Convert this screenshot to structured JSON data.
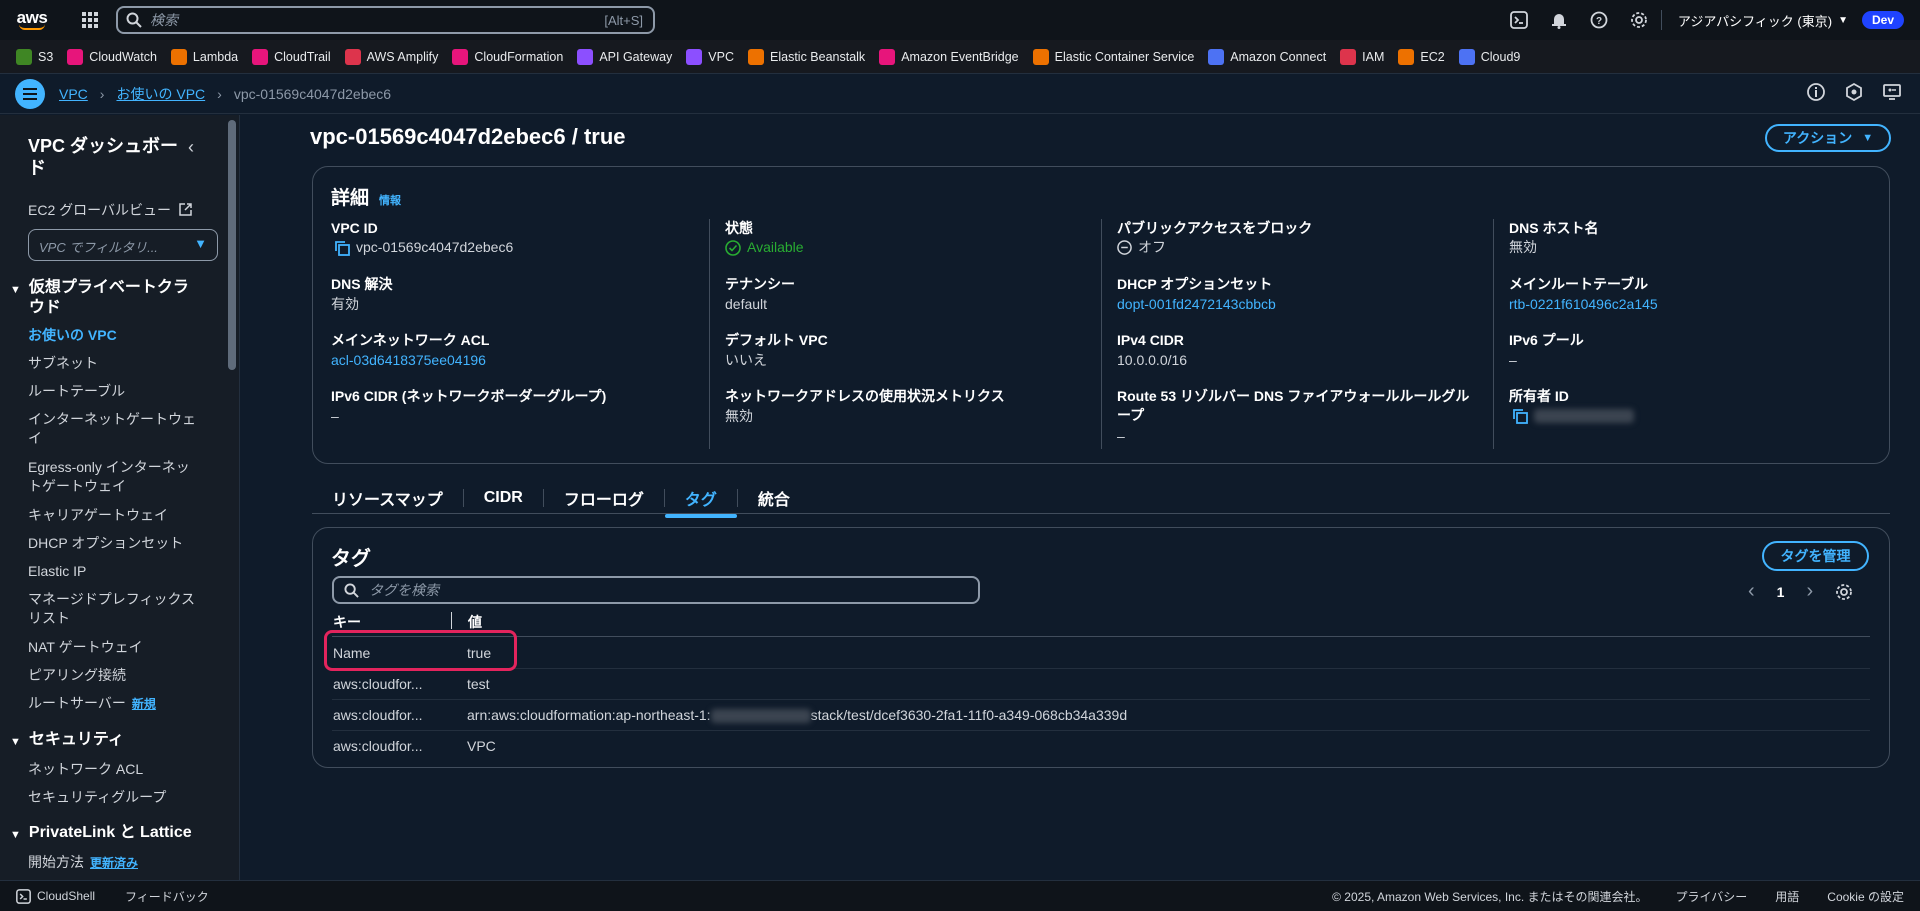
{
  "topnav": {
    "logo": "aws",
    "search_placeholder": "検索",
    "search_shortcut": "[Alt+S]",
    "region": "アジアパシフィック (東京)",
    "account_badge": "Dev"
  },
  "favorites": [
    {
      "label": "S3",
      "color": "#3f8624"
    },
    {
      "label": "CloudWatch",
      "color": "#e7157b"
    },
    {
      "label": "Lambda",
      "color": "#ed7100"
    },
    {
      "label": "CloudTrail",
      "color": "#e7157b"
    },
    {
      "label": "AWS Amplify",
      "color": "#dd344c"
    },
    {
      "label": "CloudFormation",
      "color": "#e7157b"
    },
    {
      "label": "API Gateway",
      "color": "#8c4fff"
    },
    {
      "label": "VPC",
      "color": "#8c4fff"
    },
    {
      "label": "Elastic Beanstalk",
      "color": "#ed7100"
    },
    {
      "label": "Amazon EventBridge",
      "color": "#e7157b"
    },
    {
      "label": "Elastic Container Service",
      "color": "#ed7100"
    },
    {
      "label": "Amazon Connect",
      "color": "#4d72f3"
    },
    {
      "label": "IAM",
      "color": "#dd344c"
    },
    {
      "label": "EC2",
      "color": "#ed7100"
    },
    {
      "label": "Cloud9",
      "color": "#4d72f3"
    }
  ],
  "breadcrumb": {
    "items": [
      "VPC",
      "お使いの VPC"
    ],
    "current": "vpc-01569c4047d2ebec6"
  },
  "sidebar": {
    "title": "VPC ダッシュボード",
    "ec2_global": "EC2 グローバルビュー",
    "filter_placeholder": "VPC でフィルタリ...",
    "section_vpc": "仮想プライベートクラウド",
    "items_vpc": [
      "お使いの VPC",
      "サブネット",
      "ルートテーブル",
      "インターネットゲートウェイ",
      "Egress-only インターネットゲートウェイ",
      "キャリアゲートウェイ",
      "DHCP オプションセット",
      "Elastic IP",
      "マネージドプレフィックスリスト",
      "NAT ゲートウェイ",
      "ピアリング接続",
      "ルートサーバー"
    ],
    "new_badge": "新規",
    "section_security": "セキュリティ",
    "items_security": [
      "ネットワーク ACL",
      "セキュリティグループ"
    ],
    "section_privatelink": "PrivateLink と Lattice",
    "getting_started": "開始方法",
    "updated_badge": "更新済み"
  },
  "main": {
    "title": "vpc-01569c4047d2ebec6 / true",
    "actions_label": "アクション"
  },
  "details": {
    "heading": "詳細",
    "info": "情報",
    "fields": {
      "vpc_id": {
        "label": "VPC ID",
        "value": "vpc-01569c4047d2ebec6"
      },
      "state": {
        "label": "状態",
        "value": "Available"
      },
      "block_public": {
        "label": "パブリックアクセスをブロック",
        "value": "オフ"
      },
      "dns_hostnames": {
        "label": "DNS ホスト名",
        "value": "無効"
      },
      "dns_resolution": {
        "label": "DNS 解決",
        "value": "有効"
      },
      "tenancy": {
        "label": "テナンシー",
        "value": "default"
      },
      "dhcp": {
        "label": "DHCP オプションセット",
        "value": "dopt-001fd2472143cbbcb"
      },
      "main_route": {
        "label": "メインルートテーブル",
        "value": "rtb-0221f610496c2a145"
      },
      "main_acl": {
        "label": "メインネットワーク ACL",
        "value": "acl-03d6418375ee04196"
      },
      "default_vpc": {
        "label": "デフォルト VPC",
        "value": "いいえ"
      },
      "ipv4_cidr": {
        "label": "IPv4 CIDR",
        "value": "10.0.0.0/16"
      },
      "ipv6_pool": {
        "label": "IPv6 プール",
        "value": "–"
      },
      "ipv6_cidr": {
        "label": "IPv6 CIDR (ネットワークボーダーグループ)",
        "value": "–"
      },
      "net_metrics": {
        "label": "ネットワークアドレスの使用状況メトリクス",
        "value": "無効"
      },
      "route53": {
        "label": "Route 53 リゾルバー DNS ファイアウォールルールグループ",
        "value": "–"
      },
      "owner": {
        "label": "所有者 ID",
        "value": ""
      }
    }
  },
  "tabs": [
    "リソースマップ",
    "CIDR",
    "フローログ",
    "タグ",
    "統合"
  ],
  "tags_panel": {
    "heading": "タグ",
    "manage_label": "タグを管理",
    "search_placeholder": "タグを検索",
    "page": "1",
    "col_key": "キー",
    "col_value": "値",
    "rows": [
      {
        "key": "Name",
        "value": "true"
      },
      {
        "key": "aws:cloudfor...",
        "value": "test"
      },
      {
        "key": "aws:cloudfor...",
        "value_prefix": "arn:aws:cloudformation:ap-northeast-1:",
        "value_suffix": "stack/test/dcef3630-2fa1-11f0-a349-068cb34a339d"
      },
      {
        "key": "aws:cloudfor...",
        "value": "VPC"
      }
    ]
  },
  "footer": {
    "cloudshell": "CloudShell",
    "feedback": "フィードバック",
    "copyright": "© 2025, Amazon Web Services, Inc. またはその関連会社。",
    "privacy": "プライバシー",
    "terms": "用語",
    "cookie": "Cookie の設定"
  }
}
